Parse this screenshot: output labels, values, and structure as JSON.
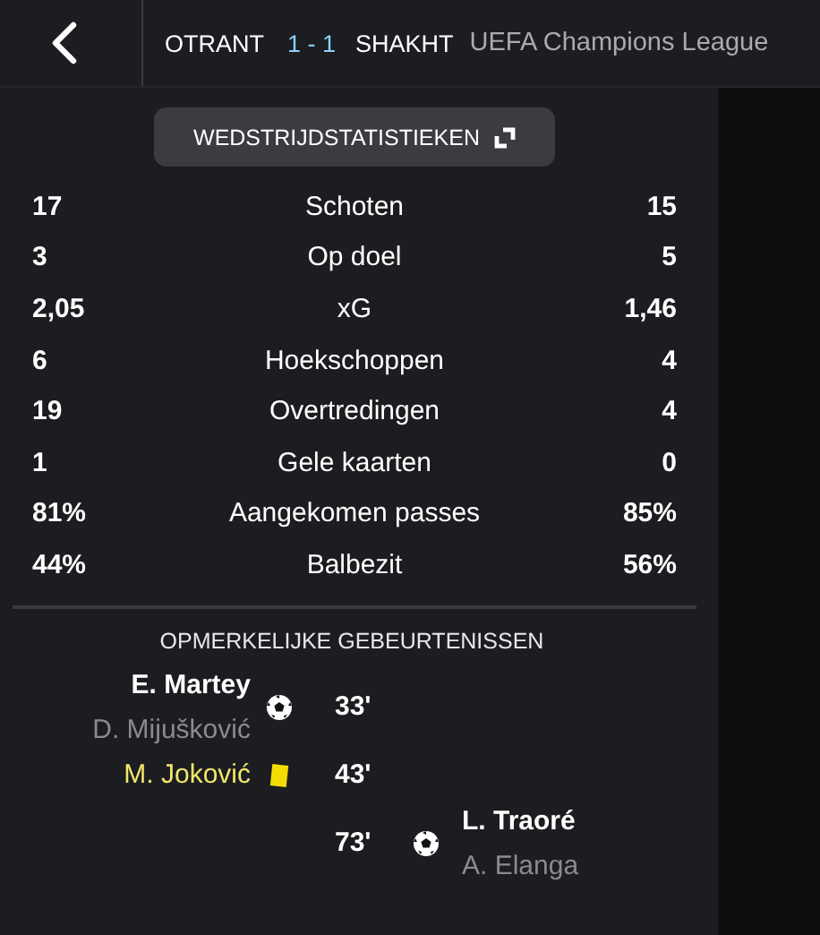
{
  "header": {
    "home_team": "OTRANT",
    "score": "1 - 1",
    "away_team": "SHAKHT",
    "competition": "UEFA Champions League"
  },
  "stats_button": {
    "label": "WEDSTRIJDSTATISTIEKEN"
  },
  "stats": [
    {
      "label": "Schoten",
      "home": "17",
      "away": "15"
    },
    {
      "label": "Op doel",
      "home": "3",
      "away": "5"
    },
    {
      "label": "xG",
      "home": "2,05",
      "away": "1,46"
    },
    {
      "label": "Hoekschoppen",
      "home": "6",
      "away": "4"
    },
    {
      "label": "Overtredingen",
      "home": "19",
      "away": "4"
    },
    {
      "label": "Gele kaarten",
      "home": "1",
      "away": "0"
    },
    {
      "label": "Aangekomen passes",
      "home": "81%",
      "away": "85%"
    },
    {
      "label": "Balbezit",
      "home": "44%",
      "away": "56%"
    }
  ],
  "events_title": "OPMERKELIJKE GEBEURTENISSEN",
  "events": [
    {
      "away": false,
      "kind": "goal",
      "minute": "33'",
      "player": "E. Martey",
      "assist": "D. Mijušković"
    },
    {
      "away": false,
      "kind": "yellow_card",
      "minute": "43'",
      "player": "M. Joković"
    },
    {
      "away": true,
      "kind": "goal",
      "minute": "73'",
      "player": "L. Traoré",
      "assist": "A. Elanga"
    }
  ]
}
